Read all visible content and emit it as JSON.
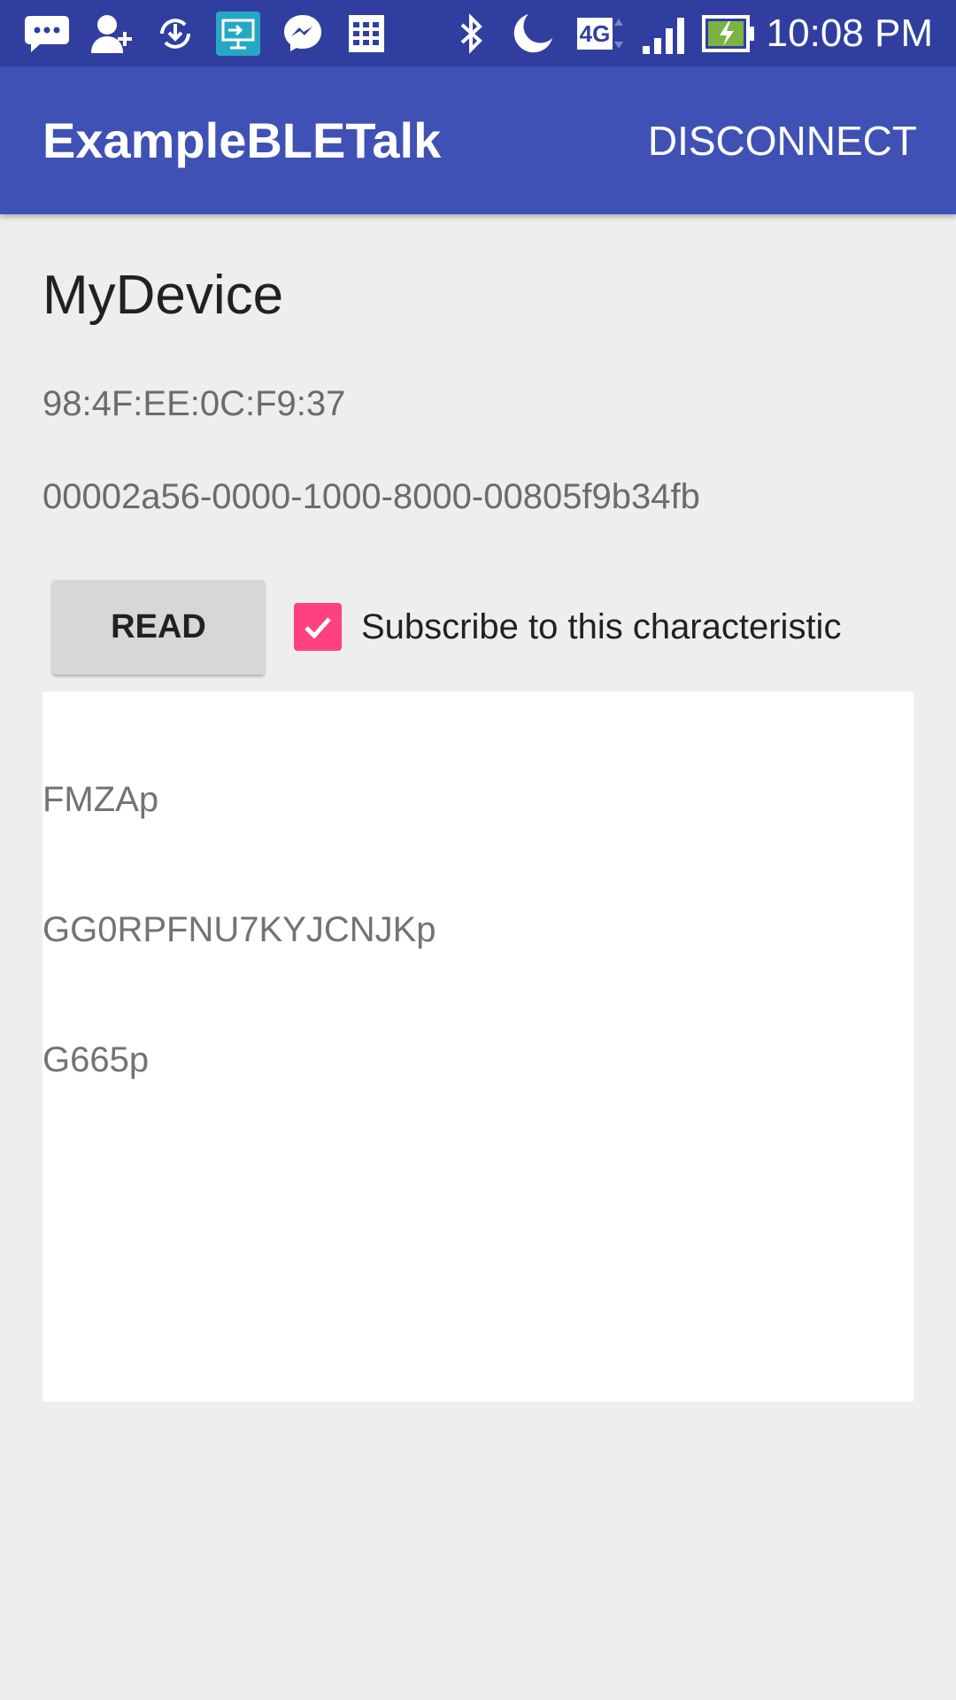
{
  "status_bar": {
    "time": "10:08 PM",
    "network_label": "4G",
    "icons": [
      "chat-bubble-icon",
      "add-person-icon",
      "download-update-icon",
      "screen-share-icon",
      "messenger-icon",
      "calendar-grid-icon",
      "bluetooth-icon",
      "do-not-disturb-moon-icon",
      "network-4g-icon",
      "cell-signal-icon",
      "battery-charging-icon"
    ]
  },
  "app_bar": {
    "title": "ExampleBLETalk",
    "action_label": "DISCONNECT"
  },
  "device": {
    "name": "MyDevice",
    "address": "98:4F:EE:0C:F9:37",
    "characteristic_uuid": "00002a56-0000-1000-8000-00805f9b34fb"
  },
  "controls": {
    "read_label": "READ",
    "subscribe_label": "Subscribe to this characteristic",
    "subscribe_checked": true
  },
  "output": {
    "lines": [
      "FMZAp",
      "GG0RPFNU7KYJCNJKp",
      "G665p"
    ]
  },
  "colors": {
    "status_bar": "#303f9f",
    "app_bar": "#3f51b5",
    "accent": "#ff4081",
    "background": "#eeeeee"
  }
}
